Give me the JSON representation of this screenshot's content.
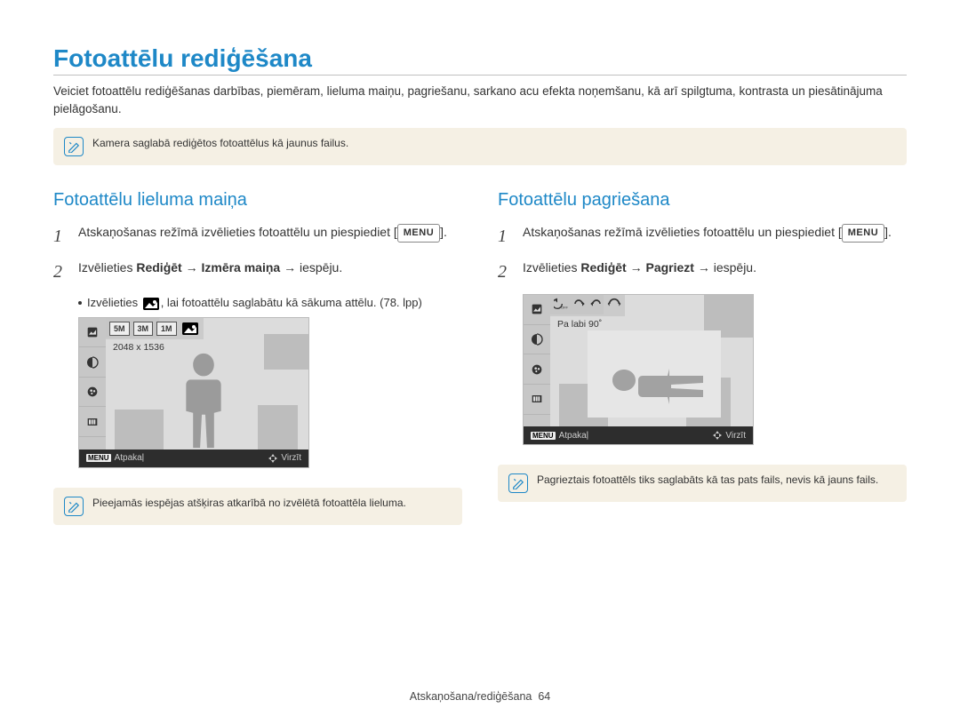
{
  "page": {
    "title": "Fotoattēlu rediģēšana",
    "intro": "Veiciet fotoattēlu rediģēšanas darbības, piemēram, lieluma maiņu, pagriešanu, sarkano acu efekta noņemšanu, kā arī spilgtuma, kontrasta un piesātinājuma pielāgošanu.",
    "note_top": "Kamera saglabā rediģētos fotoattēlus kā jaunus failus.",
    "footer_section": "Atskaņošana/rediģēšana",
    "footer_page": "64",
    "menu_label": "MENU"
  },
  "left": {
    "heading": "Fotoattēlu lieluma maiņa",
    "step1_a": "Atskaņošanas režīmā izvēlieties fotoattēlu un piespiediet",
    "step1_b": ".",
    "step2_a": "Izvēlieties ",
    "step2_b": "Rediģēt",
    "step2_c": " → ",
    "step2_d": "Izmēra maiņa",
    "step2_e": " → iespēju.",
    "bullet_a": "Izvēlieties ",
    "bullet_b": ", lai fotoattēlu saglabātu kā sākuma attēlu. (78. lpp)",
    "ss_info": "2048 x 1536",
    "ss_back": "Atpakaļ",
    "ss_move": "Virzīt",
    "chips": [
      "5M",
      "3M",
      "1M"
    ],
    "note_bottom": "Pieejamās iespējas atšķiras atkarībā no izvēlētā fotoattēla lieluma."
  },
  "right": {
    "heading": "Fotoattēlu pagriešana",
    "step1_a": "Atskaņošanas režīmā izvēlieties fotoattēlu un piespiediet",
    "step1_b": ".",
    "step2_a": "Izvēlieties ",
    "step2_b": "Rediģēt",
    "step2_c": " → ",
    "step2_d": "Pagriezt",
    "step2_e": " → iespēju.",
    "ss_info": "Pa labi 90˚",
    "ss_back": "Atpakaļ",
    "ss_move": "Virzīt",
    "note_bottom": "Pagrieztais fotoattēls tiks saglabāts kā tas pats fails, nevis kā jauns fails."
  }
}
